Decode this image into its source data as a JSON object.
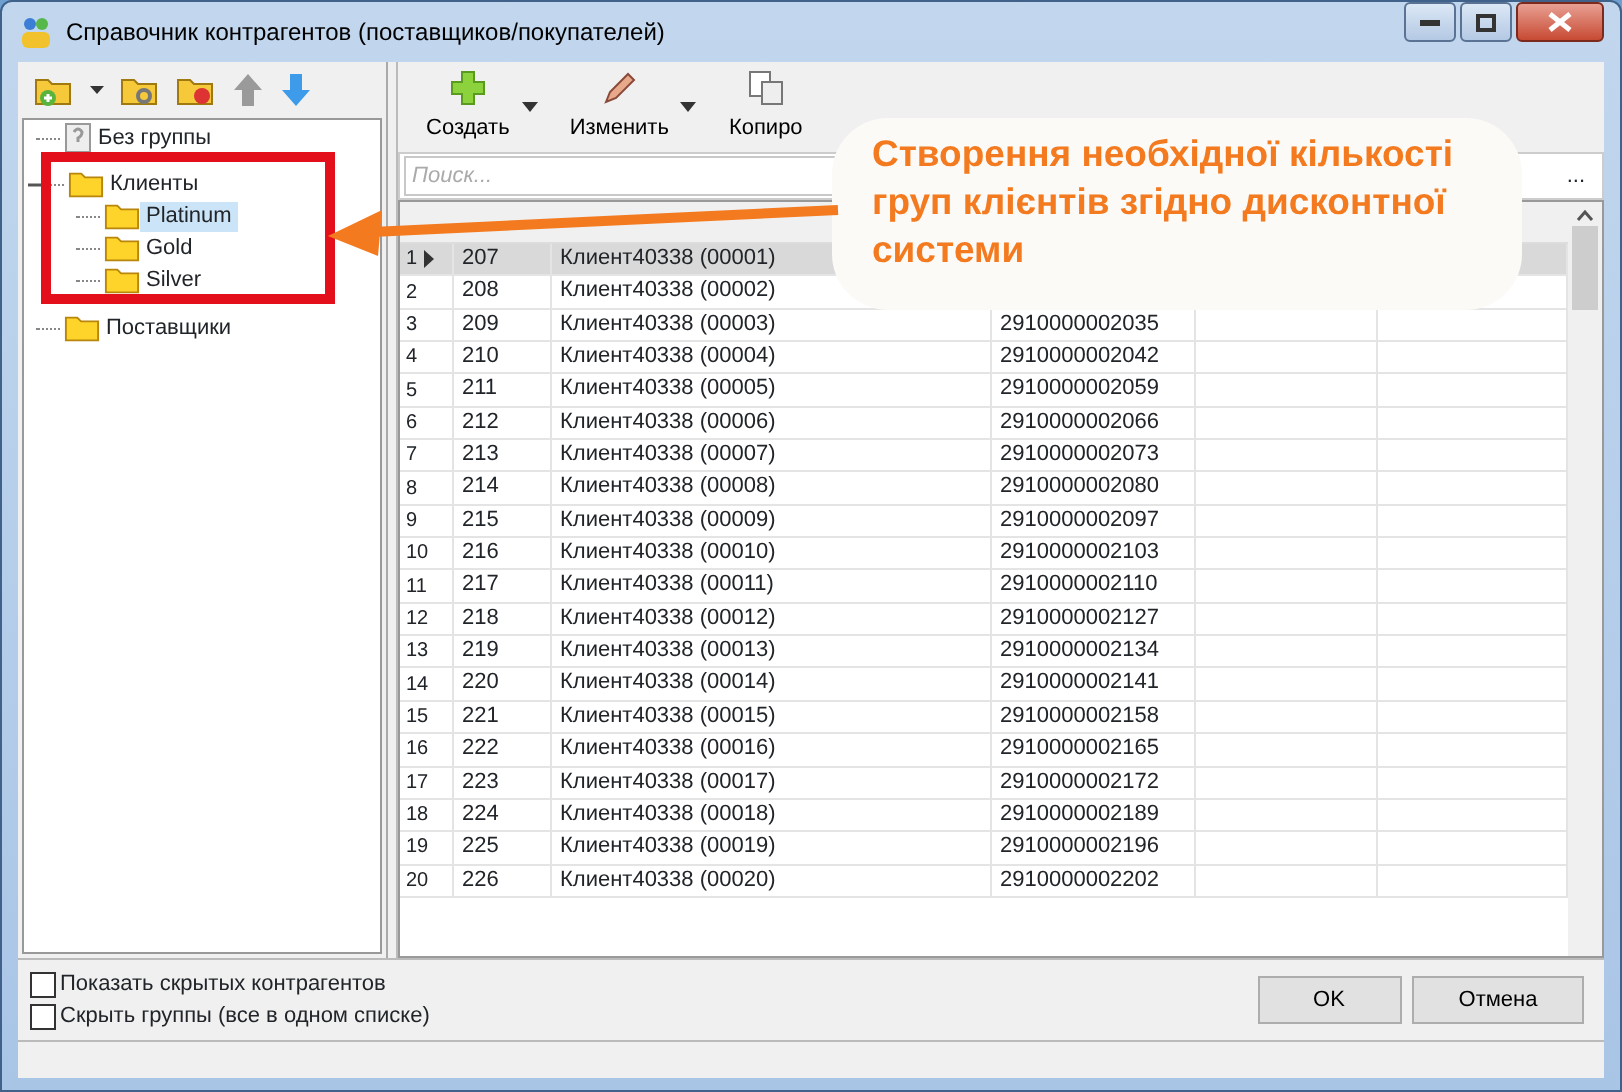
{
  "window": {
    "title": "Справочник контрагентов (поставщиков/покупателей)"
  },
  "tree": [
    {
      "label": "Без группы",
      "kind": "unknown",
      "selected": false
    },
    {
      "label": "Клиенты",
      "kind": "folder",
      "selected": false,
      "expanded": true,
      "children": [
        {
          "label": "Platinum",
          "kind": "folder",
          "selected": true
        },
        {
          "label": "Gold",
          "kind": "folder",
          "selected": false
        },
        {
          "label": "Silver",
          "kind": "folder",
          "selected": false
        }
      ]
    },
    {
      "label": "Поставщики",
      "kind": "folder",
      "selected": false
    }
  ],
  "toolbar": [
    {
      "label": "Создать",
      "kind": "create",
      "dropdown": true
    },
    {
      "label": "Изменить",
      "kind": "edit",
      "dropdown": true
    },
    {
      "label": "Копиро",
      "kind": "copy",
      "dropdown": false
    }
  ],
  "search": {
    "placeholder": "Поиск..."
  },
  "table": {
    "rows": [
      {
        "index": "1",
        "code": "207",
        "name": "Клиент40338 (00001)",
        "barcode": "",
        "selected": true
      },
      {
        "index": "2",
        "code": "208",
        "name": "Клиент40338 (00002)",
        "barcode": "",
        "selected": false
      },
      {
        "index": "3",
        "code": "209",
        "name": "Клиент40338 (00003)",
        "barcode": "2910000002035",
        "selected": false
      },
      {
        "index": "4",
        "code": "210",
        "name": "Клиент40338 (00004)",
        "barcode": "2910000002042",
        "selected": false
      },
      {
        "index": "5",
        "code": "211",
        "name": "Клиент40338 (00005)",
        "barcode": "2910000002059",
        "selected": false
      },
      {
        "index": "6",
        "code": "212",
        "name": "Клиент40338 (00006)",
        "barcode": "2910000002066",
        "selected": false
      },
      {
        "index": "7",
        "code": "213",
        "name": "Клиент40338 (00007)",
        "barcode": "2910000002073",
        "selected": false
      },
      {
        "index": "8",
        "code": "214",
        "name": "Клиент40338 (00008)",
        "barcode": "2910000002080",
        "selected": false
      },
      {
        "index": "9",
        "code": "215",
        "name": "Клиент40338 (00009)",
        "barcode": "2910000002097",
        "selected": false
      },
      {
        "index": "10",
        "code": "216",
        "name": "Клиент40338 (00010)",
        "barcode": "2910000002103",
        "selected": false
      },
      {
        "index": "11",
        "code": "217",
        "name": "Клиент40338 (00011)",
        "barcode": "2910000002110",
        "selected": false
      },
      {
        "index": "12",
        "code": "218",
        "name": "Клиент40338 (00012)",
        "barcode": "2910000002127",
        "selected": false
      },
      {
        "index": "13",
        "code": "219",
        "name": "Клиент40338 (00013)",
        "barcode": "2910000002134",
        "selected": false
      },
      {
        "index": "14",
        "code": "220",
        "name": "Клиент40338 (00014)",
        "barcode": "2910000002141",
        "selected": false
      },
      {
        "index": "15",
        "code": "221",
        "name": "Клиент40338 (00015)",
        "barcode": "2910000002158",
        "selected": false
      },
      {
        "index": "16",
        "code": "222",
        "name": "Клиент40338 (00016)",
        "barcode": "2910000002165",
        "selected": false
      },
      {
        "index": "17",
        "code": "223",
        "name": "Клиент40338 (00017)",
        "barcode": "2910000002172",
        "selected": false
      },
      {
        "index": "18",
        "code": "224",
        "name": "Клиент40338 (00018)",
        "barcode": "2910000002189",
        "selected": false
      },
      {
        "index": "19",
        "code": "225",
        "name": "Клиент40338 (00019)",
        "barcode": "2910000002196",
        "selected": false
      },
      {
        "index": "20",
        "code": "226",
        "name": "Клиент40338 (00020)",
        "barcode": "2910000002202",
        "selected": false
      }
    ]
  },
  "options": [
    {
      "label": "Показать скрытых контрагентов",
      "checked": false
    },
    {
      "label": "Скрыть группы (все в одном списке)",
      "checked": false
    }
  ],
  "buttons": [
    {
      "label": "OK"
    },
    {
      "label": "Отмена"
    }
  ],
  "column_menu": "...",
  "callout": {
    "text": "Створення  необхідної кількості груп клієнтів згідно дисконтної системи"
  }
}
